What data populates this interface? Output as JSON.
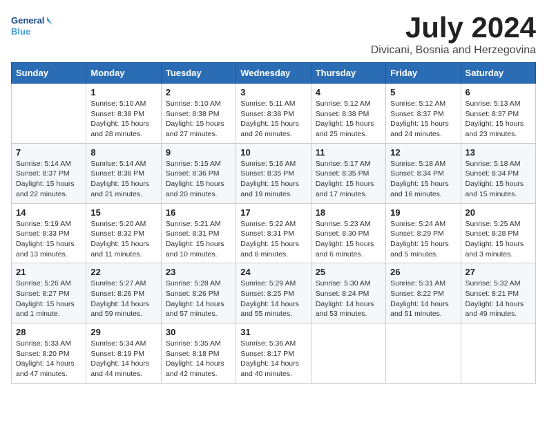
{
  "header": {
    "logo_line1": "General",
    "logo_line2": "Blue",
    "month": "July 2024",
    "location": "Divicani, Bosnia and Herzegovina"
  },
  "days_of_week": [
    "Sunday",
    "Monday",
    "Tuesday",
    "Wednesday",
    "Thursday",
    "Friday",
    "Saturday"
  ],
  "weeks": [
    [
      {
        "day": "",
        "info": ""
      },
      {
        "day": "1",
        "info": "Sunrise: 5:10 AM\nSunset: 8:38 PM\nDaylight: 15 hours\nand 28 minutes."
      },
      {
        "day": "2",
        "info": "Sunrise: 5:10 AM\nSunset: 8:38 PM\nDaylight: 15 hours\nand 27 minutes."
      },
      {
        "day": "3",
        "info": "Sunrise: 5:11 AM\nSunset: 8:38 PM\nDaylight: 15 hours\nand 26 minutes."
      },
      {
        "day": "4",
        "info": "Sunrise: 5:12 AM\nSunset: 8:38 PM\nDaylight: 15 hours\nand 25 minutes."
      },
      {
        "day": "5",
        "info": "Sunrise: 5:12 AM\nSunset: 8:37 PM\nDaylight: 15 hours\nand 24 minutes."
      },
      {
        "day": "6",
        "info": "Sunrise: 5:13 AM\nSunset: 8:37 PM\nDaylight: 15 hours\nand 23 minutes."
      }
    ],
    [
      {
        "day": "7",
        "info": "Sunrise: 5:14 AM\nSunset: 8:37 PM\nDaylight: 15 hours\nand 22 minutes."
      },
      {
        "day": "8",
        "info": "Sunrise: 5:14 AM\nSunset: 8:36 PM\nDaylight: 15 hours\nand 21 minutes."
      },
      {
        "day": "9",
        "info": "Sunrise: 5:15 AM\nSunset: 8:36 PM\nDaylight: 15 hours\nand 20 minutes."
      },
      {
        "day": "10",
        "info": "Sunrise: 5:16 AM\nSunset: 8:35 PM\nDaylight: 15 hours\nand 19 minutes."
      },
      {
        "day": "11",
        "info": "Sunrise: 5:17 AM\nSunset: 8:35 PM\nDaylight: 15 hours\nand 17 minutes."
      },
      {
        "day": "12",
        "info": "Sunrise: 5:18 AM\nSunset: 8:34 PM\nDaylight: 15 hours\nand 16 minutes."
      },
      {
        "day": "13",
        "info": "Sunrise: 5:18 AM\nSunset: 8:34 PM\nDaylight: 15 hours\nand 15 minutes."
      }
    ],
    [
      {
        "day": "14",
        "info": "Sunrise: 5:19 AM\nSunset: 8:33 PM\nDaylight: 15 hours\nand 13 minutes."
      },
      {
        "day": "15",
        "info": "Sunrise: 5:20 AM\nSunset: 8:32 PM\nDaylight: 15 hours\nand 11 minutes."
      },
      {
        "day": "16",
        "info": "Sunrise: 5:21 AM\nSunset: 8:31 PM\nDaylight: 15 hours\nand 10 minutes."
      },
      {
        "day": "17",
        "info": "Sunrise: 5:22 AM\nSunset: 8:31 PM\nDaylight: 15 hours\nand 8 minutes."
      },
      {
        "day": "18",
        "info": "Sunrise: 5:23 AM\nSunset: 8:30 PM\nDaylight: 15 hours\nand 6 minutes."
      },
      {
        "day": "19",
        "info": "Sunrise: 5:24 AM\nSunset: 8:29 PM\nDaylight: 15 hours\nand 5 minutes."
      },
      {
        "day": "20",
        "info": "Sunrise: 5:25 AM\nSunset: 8:28 PM\nDaylight: 15 hours\nand 3 minutes."
      }
    ],
    [
      {
        "day": "21",
        "info": "Sunrise: 5:26 AM\nSunset: 8:27 PM\nDaylight: 15 hours\nand 1 minute."
      },
      {
        "day": "22",
        "info": "Sunrise: 5:27 AM\nSunset: 8:26 PM\nDaylight: 14 hours\nand 59 minutes."
      },
      {
        "day": "23",
        "info": "Sunrise: 5:28 AM\nSunset: 8:26 PM\nDaylight: 14 hours\nand 57 minutes."
      },
      {
        "day": "24",
        "info": "Sunrise: 5:29 AM\nSunset: 8:25 PM\nDaylight: 14 hours\nand 55 minutes."
      },
      {
        "day": "25",
        "info": "Sunrise: 5:30 AM\nSunset: 8:24 PM\nDaylight: 14 hours\nand 53 minutes."
      },
      {
        "day": "26",
        "info": "Sunrise: 5:31 AM\nSunset: 8:22 PM\nDaylight: 14 hours\nand 51 minutes."
      },
      {
        "day": "27",
        "info": "Sunrise: 5:32 AM\nSunset: 8:21 PM\nDaylight: 14 hours\nand 49 minutes."
      }
    ],
    [
      {
        "day": "28",
        "info": "Sunrise: 5:33 AM\nSunset: 8:20 PM\nDaylight: 14 hours\nand 47 minutes."
      },
      {
        "day": "29",
        "info": "Sunrise: 5:34 AM\nSunset: 8:19 PM\nDaylight: 14 hours\nand 44 minutes."
      },
      {
        "day": "30",
        "info": "Sunrise: 5:35 AM\nSunset: 8:18 PM\nDaylight: 14 hours\nand 42 minutes."
      },
      {
        "day": "31",
        "info": "Sunrise: 5:36 AM\nSunset: 8:17 PM\nDaylight: 14 hours\nand 40 minutes."
      },
      {
        "day": "",
        "info": ""
      },
      {
        "day": "",
        "info": ""
      },
      {
        "day": "",
        "info": ""
      }
    ]
  ]
}
